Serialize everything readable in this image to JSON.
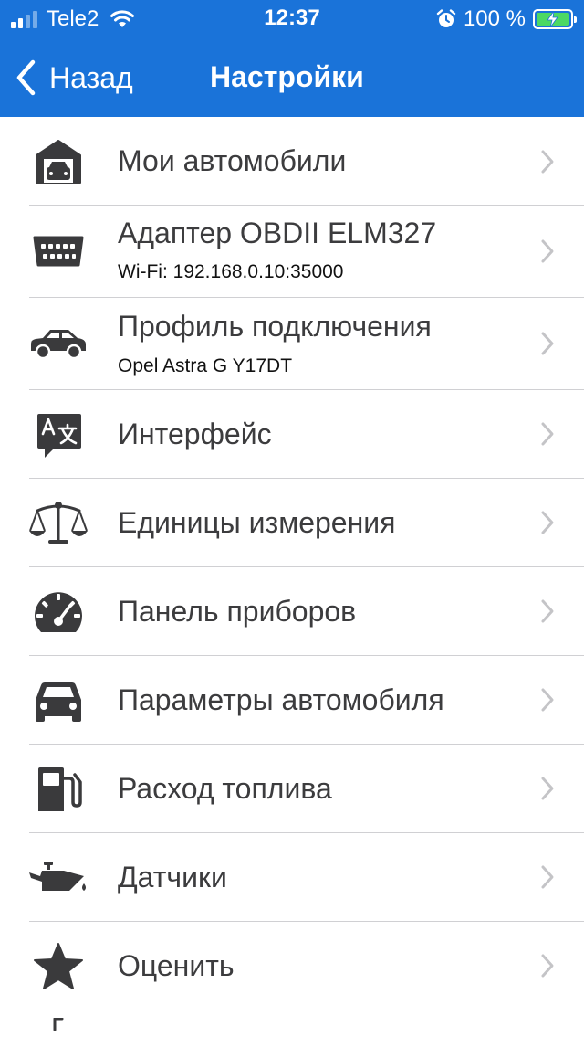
{
  "status_bar": {
    "carrier": "Tele2",
    "time": "12:37",
    "battery_percent": "100 %",
    "signal_bars_filled": 2,
    "signal_bars_total": 4,
    "icons": [
      "wifi-icon",
      "alarm-icon",
      "battery-charging-icon"
    ]
  },
  "nav": {
    "back_label": "Назад",
    "title": "Настройки"
  },
  "items": [
    {
      "id": "my-cars",
      "title": "Мои автомобили",
      "subtitle": "",
      "icon": "garage-car-icon"
    },
    {
      "id": "adapter",
      "title": "Адаптер OBDII ELM327",
      "subtitle": "Wi-Fi: 192.168.0.10:35000",
      "icon": "obd-connector-icon"
    },
    {
      "id": "connection-profile",
      "title": "Профиль подключения",
      "subtitle": "Opel Astra G Y17DT",
      "icon": "car-side-icon"
    },
    {
      "id": "interface",
      "title": "Интерфейс",
      "subtitle": "",
      "icon": "translate-icon"
    },
    {
      "id": "units",
      "title": "Единицы измерения",
      "subtitle": "",
      "icon": "scales-icon"
    },
    {
      "id": "dashboard",
      "title": "Панель приборов",
      "subtitle": "",
      "icon": "speedometer-icon"
    },
    {
      "id": "car-params",
      "title": "Параметры автомобиля",
      "subtitle": "",
      "icon": "car-front-icon"
    },
    {
      "id": "fuel",
      "title": "Расход топлива",
      "subtitle": "",
      "icon": "fuel-pump-icon"
    },
    {
      "id": "sensors",
      "title": "Датчики",
      "subtitle": "",
      "icon": "oil-can-icon"
    },
    {
      "id": "rate",
      "title": "Оценить",
      "subtitle": "",
      "icon": "star-icon"
    }
  ],
  "colors": {
    "header_bg": "#1a73d9",
    "text": "#3c3c3e",
    "icon": "#3a3a3c",
    "chevron": "#c4c4c7",
    "separator": "#d0d0d3",
    "battery_fill": "#4cd964"
  }
}
